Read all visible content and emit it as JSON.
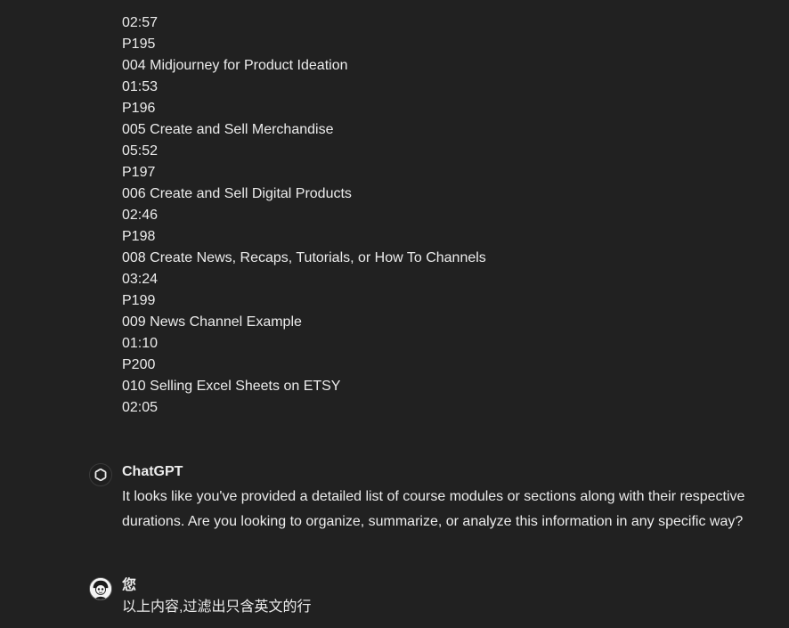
{
  "conversation": {
    "first_message_lines": [
      "02:57",
      "P195",
      "004 Midjourney for Product Ideation",
      "01:53",
      "P196",
      "005 Create and Sell Merchandise",
      "05:52",
      "P197",
      "006 Create and Sell Digital Products",
      "02:46",
      "P198",
      "008 Create News, Recaps, Tutorials, or How To Channels",
      "03:24",
      "P199",
      "009 News Channel Example",
      "01:10",
      "P200",
      "010 Selling Excel Sheets on ETSY",
      "02:05"
    ],
    "assistant": {
      "sender": "ChatGPT",
      "avatar_icon": "openai-logo-icon",
      "text": "It looks like you've provided a detailed list of course modules or sections along with their respective durations. Are you looking to organize, summarize, or analyze this information in any specific way?"
    },
    "user": {
      "sender": "您",
      "avatar_icon": "user-avatar-icon",
      "text": "以上内容,过滤出只含英文的行"
    }
  }
}
